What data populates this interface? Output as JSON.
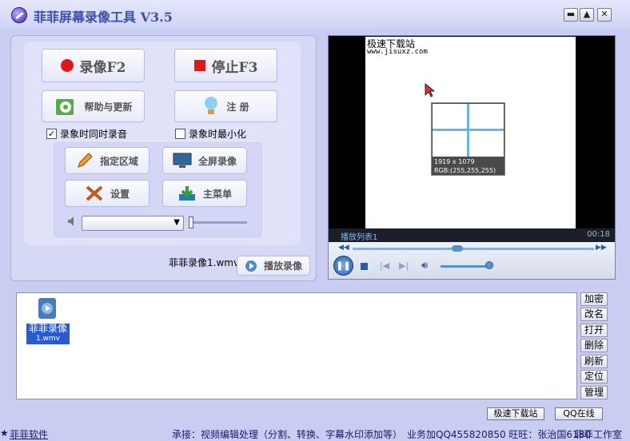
{
  "window": {
    "title": "菲菲屏幕录像工具 V3.5"
  },
  "controls": {
    "record_label": "录像F2",
    "stop_label": "停止F3",
    "help_label": "帮助与更新",
    "register_label": "注 册",
    "record_audio_label": "录象时同时录音",
    "minimize_label": "录象时最小化",
    "region_label": "指定区域",
    "fullscreen_label": "全屏录像",
    "settings_label": "设置",
    "main_menu_label": "主菜单",
    "current_file": "菲菲录像1.wmv",
    "play_label": "播放录像"
  },
  "player": {
    "watermark_line1": "极速下载站",
    "watermark_line2": "www.jisuxz.com",
    "magnifier_size": "1919 x 1079",
    "magnifier_rgb": "RGB:(255,255,255)",
    "playlist_label": "播放列表1",
    "time": "00:18"
  },
  "files": [
    {
      "name_line1": "菲菲录像",
      "name_line2": "1.wmv"
    }
  ],
  "side_buttons": [
    "加密",
    "改名",
    "打开",
    "删除",
    "刷新",
    "定位",
    "管理"
  ],
  "bottom_buttons": {
    "left": "极速下载站",
    "right": "QQ在线"
  },
  "status": {
    "company": "菲菲软件",
    "ad_text": "承接：视频编辑处理（分割、转换、字幕水印添加等）",
    "business": "业务加QQ455820850 旺旺：张治国6180",
    "studio": "菲菲工作室"
  },
  "colors": {
    "accent": "#3c4fa8",
    "record": "#e01818",
    "bg": "#c9cdf2"
  }
}
